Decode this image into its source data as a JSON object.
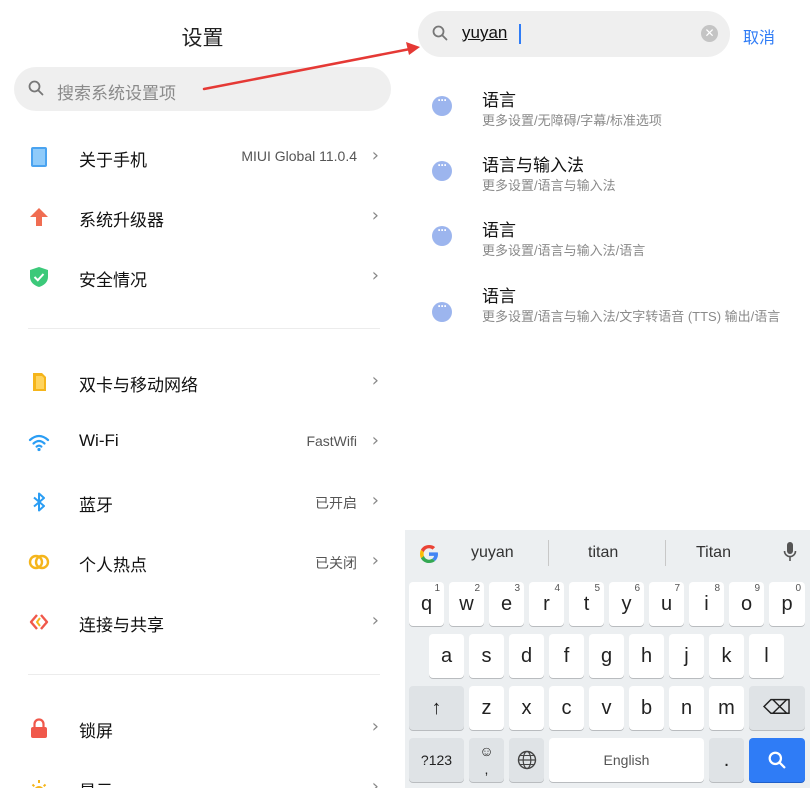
{
  "settings": {
    "title": "设置",
    "search_placeholder": "搜索系统设置项",
    "items": [
      {
        "label": "关于手机",
        "value": "MIUI Global 11.0.4",
        "icon": "phone-icon",
        "color": "#4aa3f0"
      },
      {
        "label": "系统升级器",
        "value": "",
        "icon": "upgrade-arrow-icon",
        "color": "#f06d52"
      },
      {
        "label": "安全情况",
        "value": "",
        "icon": "shield-check-icon",
        "color": "#3cc97a"
      },
      {
        "label": "双卡与移动网络",
        "value": "",
        "icon": "sim-card-icon",
        "color": "#f5b51b"
      },
      {
        "label": "Wi-Fi",
        "value": "FastWifi",
        "icon": "wifi-icon",
        "color": "#2a9df4"
      },
      {
        "label": "蓝牙",
        "value": "已开启",
        "icon": "bluetooth-icon",
        "color": "#2a9df4"
      },
      {
        "label": "个人热点",
        "value": "已关闭",
        "icon": "hotspot-icon",
        "color": "#f5b51b"
      },
      {
        "label": "连接与共享",
        "value": "",
        "icon": "share-icon",
        "color": "#f0584b"
      },
      {
        "label": "锁屏",
        "value": "",
        "icon": "lock-icon",
        "color": "#f0584b"
      },
      {
        "label": "显示",
        "value": "",
        "icon": "brightness-icon",
        "color": "#f5b51b"
      }
    ]
  },
  "search": {
    "query": "yuyan",
    "cancel_label": "取消",
    "results": [
      {
        "title": "语言",
        "path": "更多设置/无障碍/字幕/标准选项"
      },
      {
        "title": "语言与输入法",
        "path": "更多设置/语言与输入法"
      },
      {
        "title": "语言",
        "path": "更多设置/语言与输入法/语言"
      },
      {
        "title": "语言",
        "path": "更多设置/语言与输入法/文字转语音 (TTS) 输出/语言"
      }
    ]
  },
  "keyboard": {
    "suggestions": [
      "yuyan",
      "titan",
      "Titan"
    ],
    "row1": [
      {
        "k": "q",
        "n": "1"
      },
      {
        "k": "w",
        "n": "2"
      },
      {
        "k": "e",
        "n": "3"
      },
      {
        "k": "r",
        "n": "4"
      },
      {
        "k": "t",
        "n": "5"
      },
      {
        "k": "y",
        "n": "6"
      },
      {
        "k": "u",
        "n": "7"
      },
      {
        "k": "i",
        "n": "8"
      },
      {
        "k": "o",
        "n": "9"
      },
      {
        "k": "p",
        "n": "0"
      }
    ],
    "row2": [
      "a",
      "s",
      "d",
      "f",
      "g",
      "h",
      "j",
      "k",
      "l"
    ],
    "row3": [
      "z",
      "x",
      "c",
      "v",
      "b",
      "n",
      "m"
    ],
    "symbols_label": "?123",
    "emoji_label": "☺\n,",
    "space_label": "English",
    "period_label": ".",
    "shift_glyph": "↑",
    "backspace_glyph": "⌫"
  },
  "colors": {
    "accent": "#2f7cf6",
    "annotation_arrow": "#e53935"
  }
}
